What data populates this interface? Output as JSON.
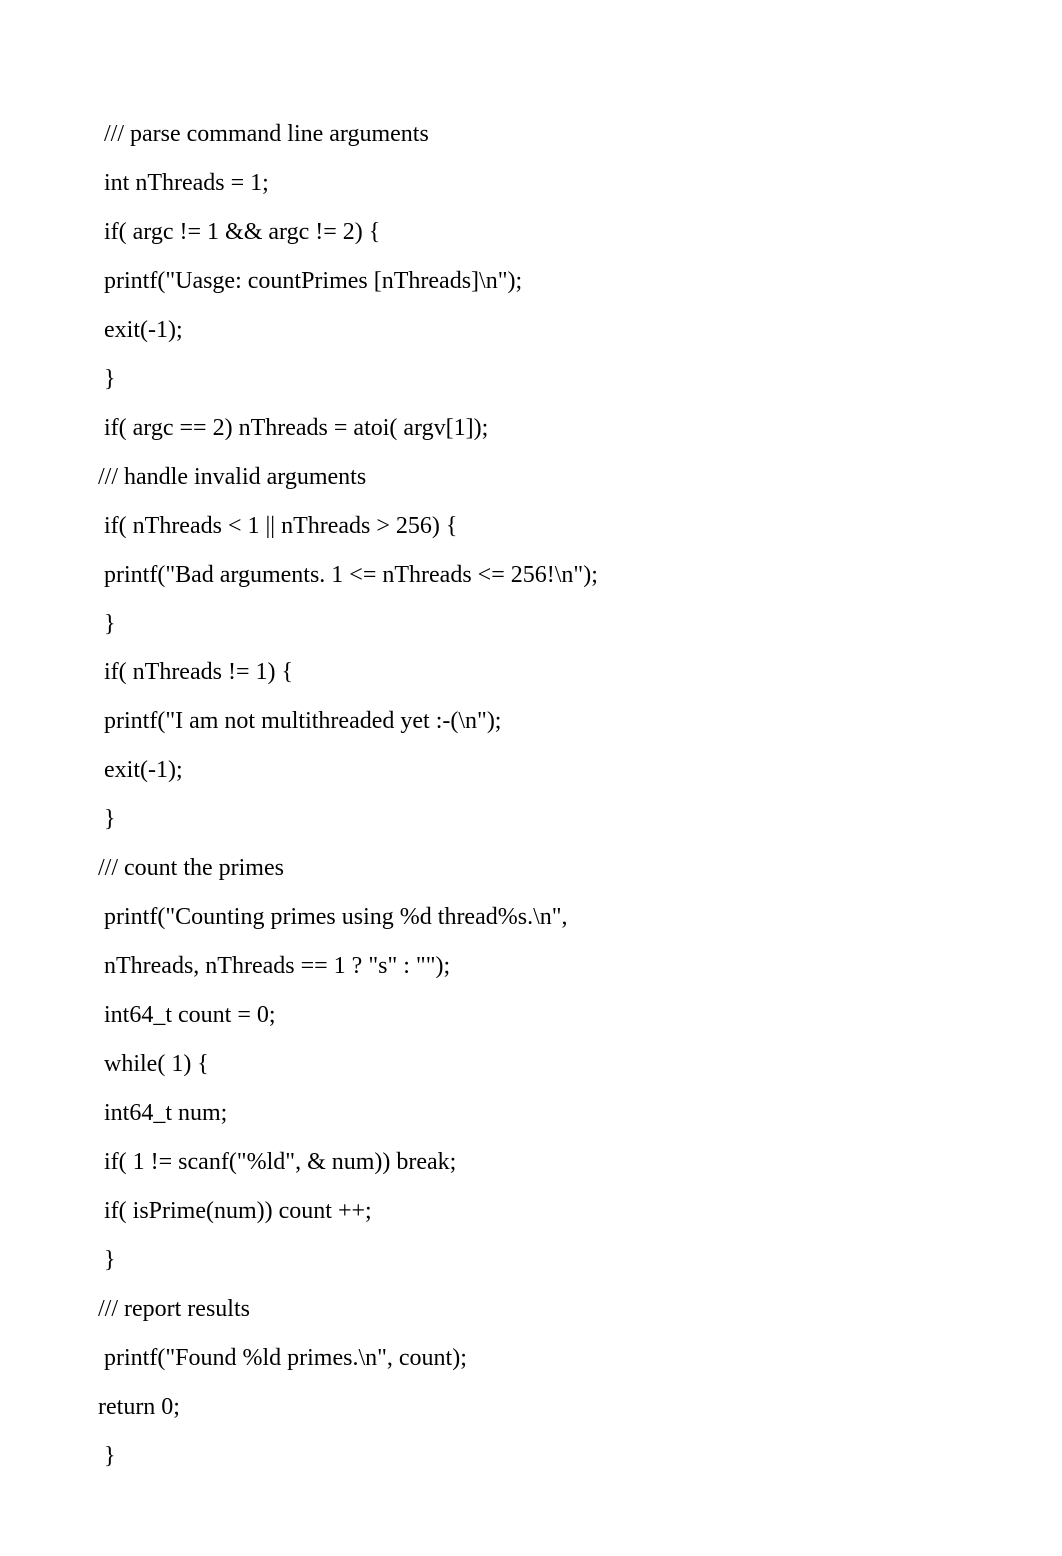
{
  "code_lines": [
    " /// parse command line arguments",
    " int nThreads = 1;",
    " if( argc != 1 && argc != 2) {",
    " printf(\"Uasge: countPrimes [nThreads]\\n\");",
    " exit(-1);",
    " }",
    " if( argc == 2) nThreads = atoi( argv[1]);",
    "/// handle invalid arguments",
    " if( nThreads < 1 || nThreads > 256) {",
    " printf(\"Bad arguments. 1 <= nThreads <= 256!\\n\");",
    " }",
    " if( nThreads != 1) {",
    " printf(\"I am not multithreaded yet :-(\\n\");",
    " exit(-1);",
    " }",
    "/// count the primes",
    " printf(\"Counting primes using %d thread%s.\\n\",",
    " nThreads, nThreads == 1 ? \"s\" : \"\");",
    " int64_t count = 0;",
    " while( 1) {",
    " int64_t num;",
    " if( 1 != scanf(\"%ld\", & num)) break;",
    " if( isPrime(num)) count ++;",
    " }",
    "/// report results",
    " printf(\"Found %ld primes.\\n\", count);",
    "return 0;",
    " }"
  ]
}
